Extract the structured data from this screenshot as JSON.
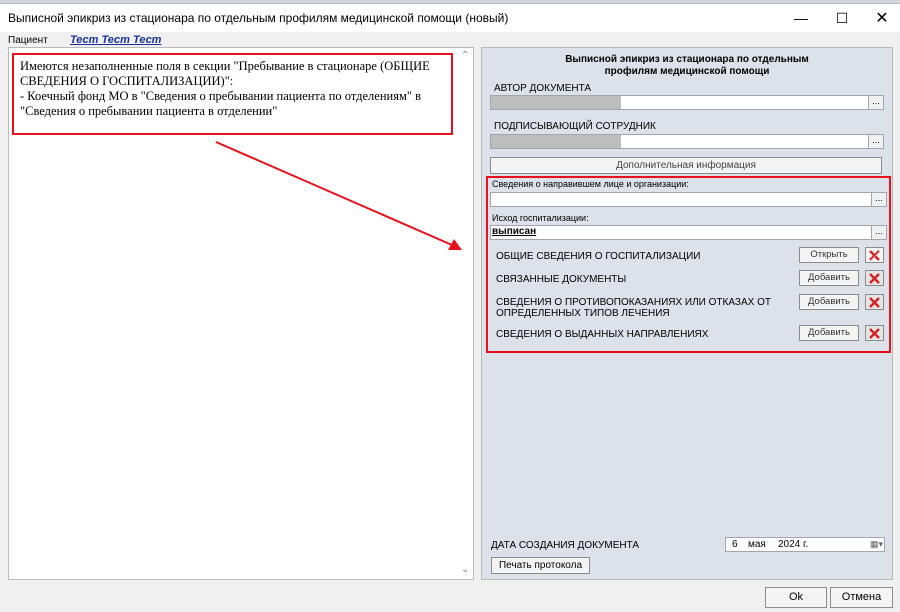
{
  "window": {
    "title": "Выписной эпикриз из стационара по отдельным профилям медицинской помощи (новый)",
    "min_glyph": "—",
    "max_glyph": "☐",
    "close_glyph": "✕"
  },
  "patient": {
    "label": "Пациент",
    "name": "Тест Тест Тест"
  },
  "warning": {
    "line1": "Имеются незаполненные поля в секции \"Пребывание в стационаре (ОБЩИЕ СВЕДЕНИЯ О ГОСПИТАЛИЗАЦИИ)\":",
    "line2": "- Коечный фонд МО в \"Сведения о пребывании пациента по отделениям\" в \"Сведения о пребывании пациента в отделении\""
  },
  "document": {
    "title": "Выписной эпикриз из стационара по отдельным профилям медицинской помощи",
    "author_label": "АВТОР ДОКУМЕНТА",
    "signer_label": "ПОДПИСЫВАЮЩИЙ СОТРУДНИК",
    "lookup_button": "...",
    "extra_info_button": "Дополнительная информация",
    "referrer_label": "Сведения о направившем лице и организации:",
    "outcome_label": "Исход госпитализации:",
    "outcome_value": "выписан",
    "sections": [
      {
        "label": "ОБЩИЕ СВЕДЕНИЯ О ГОСПИТАЛИЗАЦИИ",
        "action": "Открыть"
      },
      {
        "label": "СВЯЗАННЫЕ ДОКУМЕНТЫ",
        "action": "Добавить"
      },
      {
        "label": "СВЕДЕНИЯ О ПРОТИВОПОКАЗАНИЯХ ИЛИ ОТКАЗАХ ОТ ОПРЕДЕЛЕННЫХ ТИПОВ ЛЕЧЕНИЯ",
        "action": "Добавить"
      },
      {
        "label": "СВЕДЕНИЯ О ВЫДАННЫХ НАПРАВЛЕНИЯХ",
        "action": "Добавить"
      }
    ],
    "date_label": "ДАТА СОЗДАНИЯ ДОКУМЕНТА",
    "date": {
      "day": "6",
      "month": "мая",
      "year": "2024 г."
    },
    "print_button": "Печать протокола"
  },
  "footer": {
    "ok": "Ok",
    "cancel": "Отмена"
  },
  "colors": {
    "highlight": "#e8101a",
    "link": "#1a2f9c",
    "panel": "#dde1e9"
  }
}
